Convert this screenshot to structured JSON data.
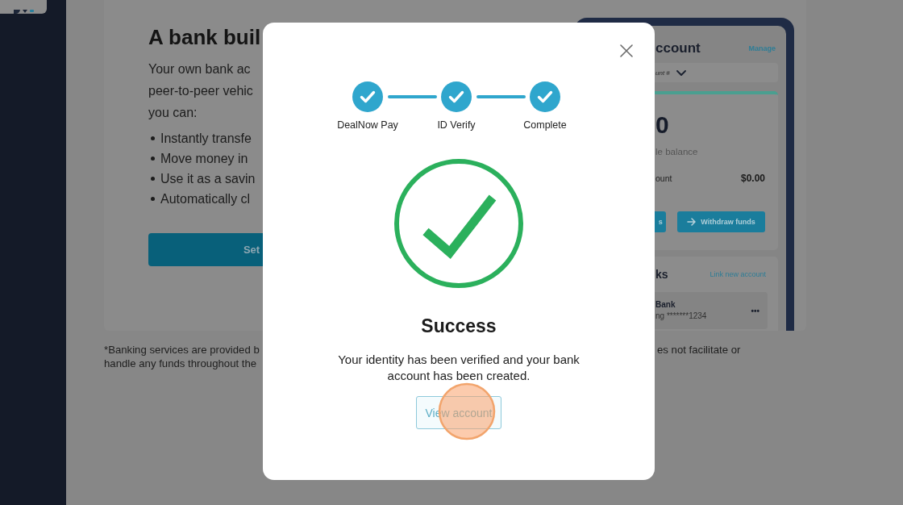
{
  "page": {
    "heading": "A bank buil",
    "intro_lines": [
      "Your own bank ac",
      "peer-to-peer vehic",
      "you can:"
    ],
    "bullets": [
      "Instantly transfe",
      "Move money in",
      "Use it as a savin",
      "Automatically cl"
    ],
    "primary_button": "Set",
    "footnote": {
      "left_lines": [
        "*Banking services are provided b",
        "handle any funds throughout the"
      ],
      "right_lines": [
        "es not facilitate or"
      ]
    }
  },
  "phone_preview": {
    "title": "ccount",
    "manage_link": "Manage",
    "account_select": "unt #",
    "balance": "0",
    "balance_label": "le balance",
    "summary": {
      "label": "ount",
      "value": "$0.00"
    },
    "partial_button": "s",
    "withdraw_button": "Withdraw funds",
    "linked": {
      "title": "ks",
      "link": "Link new account",
      "accounts": [
        {
          "name": "Bank",
          "number": "ng *******1234",
          "more": "•••"
        }
      ]
    }
  },
  "modal": {
    "steps": [
      {
        "label": "DealNow Pay",
        "completed": true
      },
      {
        "label": "ID Verify",
        "completed": true
      },
      {
        "label": "Complete",
        "completed": true
      }
    ],
    "title": "Success",
    "message": "Your identity has been verified and your bank account has been created.",
    "action": {
      "label": "View account",
      "highlighted": true
    }
  }
}
